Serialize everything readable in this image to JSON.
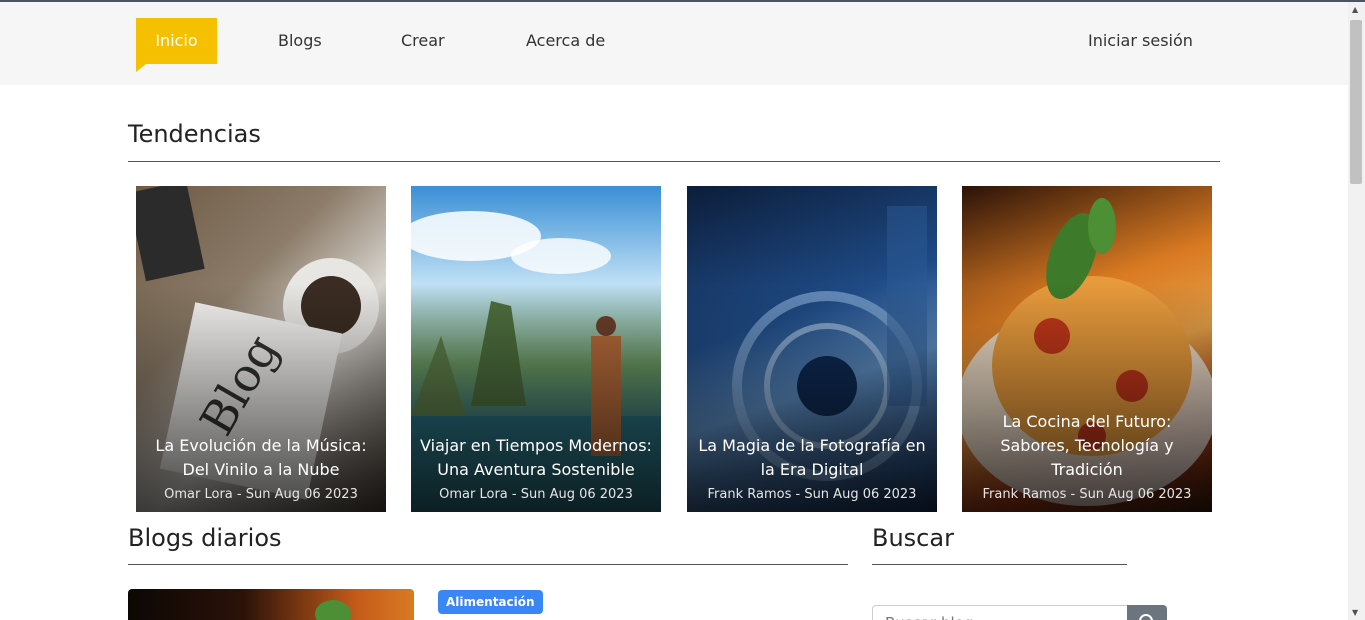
{
  "nav": {
    "items": [
      {
        "label": "Inicio",
        "active": true
      },
      {
        "label": "Blogs",
        "active": false
      },
      {
        "label": "Crear",
        "active": false
      },
      {
        "label": "Acerca de",
        "active": false
      }
    ],
    "login_label": "Iniciar sesión"
  },
  "trending": {
    "title": "Tendencias",
    "cards": [
      {
        "title": "La Evolución de la Música: Del Vinilo a la Nube",
        "meta": "Omar Lora - Sun Aug 06 2023"
      },
      {
        "title": "Viajar en Tiempos Modernos: Una Aventura Sostenible",
        "meta": "Omar Lora - Sun Aug 06 2023"
      },
      {
        "title": "La Magia de la Fotografía en la Era Digital",
        "meta": "Frank Ramos - Sun Aug 06 2023"
      },
      {
        "title": "La Cocina del Futuro: Sabores, Tecnología y Tradición",
        "meta": "Frank Ramos - Sun Aug 06 2023"
      }
    ]
  },
  "daily": {
    "title": "Blogs diarios",
    "first_post": {
      "category": "Alimentación"
    }
  },
  "search": {
    "title": "Buscar",
    "placeholder": "Buscar blog..."
  },
  "colors": {
    "accent": "#f5c000",
    "badge": "#3b86f5",
    "search_button": "#6c757d"
  }
}
